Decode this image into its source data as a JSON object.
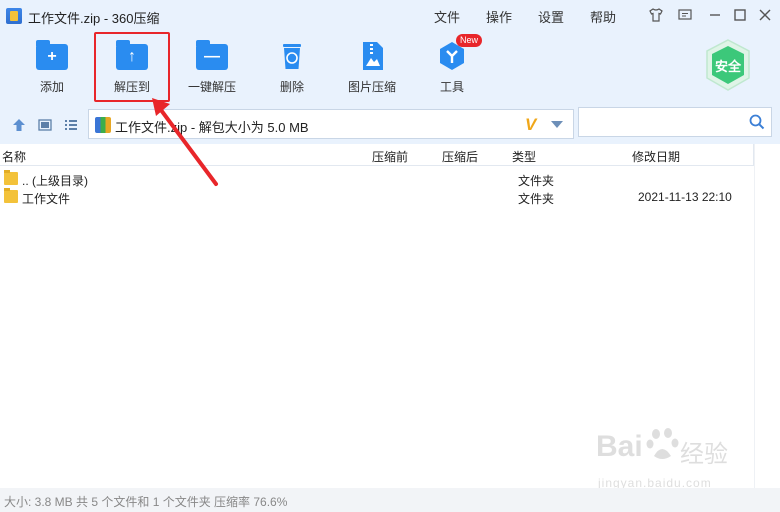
{
  "window": {
    "title": "工作文件.zip - 360压缩",
    "menu": [
      "文件",
      "操作",
      "设置",
      "帮助"
    ]
  },
  "toolbar": {
    "items": [
      {
        "label": "添加",
        "icon": "add-folder-icon"
      },
      {
        "label": "解压到",
        "icon": "extract-to-icon"
      },
      {
        "label": "一键解压",
        "icon": "one-click-extract-icon"
      },
      {
        "label": "删除",
        "icon": "recycle-bin-icon"
      },
      {
        "label": "图片压缩",
        "icon": "image-compress-icon"
      },
      {
        "label": "工具",
        "icon": "tools-icon",
        "badge": "New"
      }
    ],
    "safe_badge": "安全"
  },
  "address": {
    "path": "工作文件.zip - 解包大小为 5.0 MB",
    "search_placeholder": ""
  },
  "columns": [
    "名称",
    "压缩前",
    "压缩后",
    "类型",
    "修改日期"
  ],
  "rows": [
    {
      "name": ".. (上级目录)",
      "type": "文件夹",
      "date": ""
    },
    {
      "name": "工作文件",
      "type": "文件夹",
      "date": "2021-11-13 22:10"
    }
  ],
  "status": "大小: 3.8 MB 共 5 个文件和 1 个文件夹 压缩率 76.6%",
  "watermark": {
    "brand": "Bai",
    "brand2": "经验",
    "url": "jingyan.baidu.com"
  },
  "colors": {
    "accent": "#2a8cf0",
    "highlight": "#e8262a",
    "safe": "#3cc87a"
  }
}
